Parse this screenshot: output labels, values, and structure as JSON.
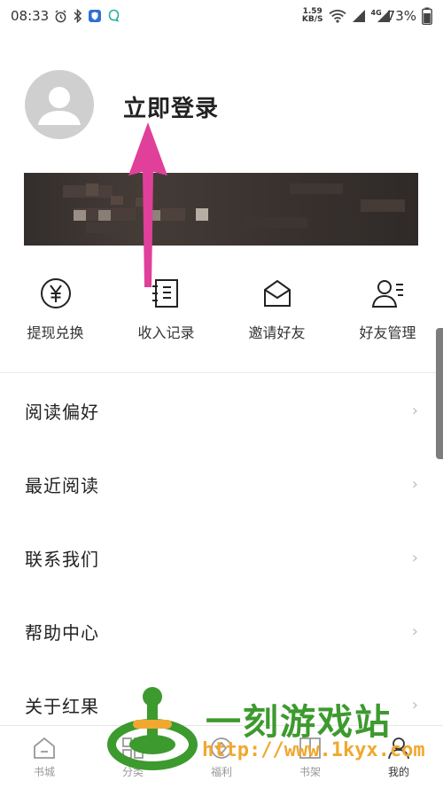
{
  "status_bar": {
    "time": "08:33",
    "net_speed_value": "1.59",
    "net_speed_unit": "KB/S",
    "network": "4G",
    "battery": "73%"
  },
  "profile": {
    "login_label": "立即登录"
  },
  "actions": [
    {
      "label": "提现兑换",
      "icon": "yen-coin-icon"
    },
    {
      "label": "收入记录",
      "icon": "notebook-icon"
    },
    {
      "label": "邀请好友",
      "icon": "envelope-icon"
    },
    {
      "label": "好友管理",
      "icon": "user-list-icon"
    }
  ],
  "menu": [
    {
      "label": "阅读偏好"
    },
    {
      "label": "最近阅读"
    },
    {
      "label": "联系我们"
    },
    {
      "label": "帮助中心"
    },
    {
      "label": "关于红果"
    }
  ],
  "bottom_nav": [
    {
      "label": "书城",
      "icon": "home-icon"
    },
    {
      "label": "分类",
      "icon": "grid-icon"
    },
    {
      "label": "福利",
      "icon": "gift-icon"
    },
    {
      "label": "书架",
      "icon": "bookshelf-icon"
    },
    {
      "label": "我的",
      "icon": "user-icon",
      "active": true
    }
  ],
  "watermark": {
    "title": "一刻游戏站",
    "url": "http://www.1kyx.com"
  },
  "colors": {
    "arrow": "#e0409a",
    "watermark_green": "#3d9a2e",
    "watermark_orange": "#f0a830"
  }
}
